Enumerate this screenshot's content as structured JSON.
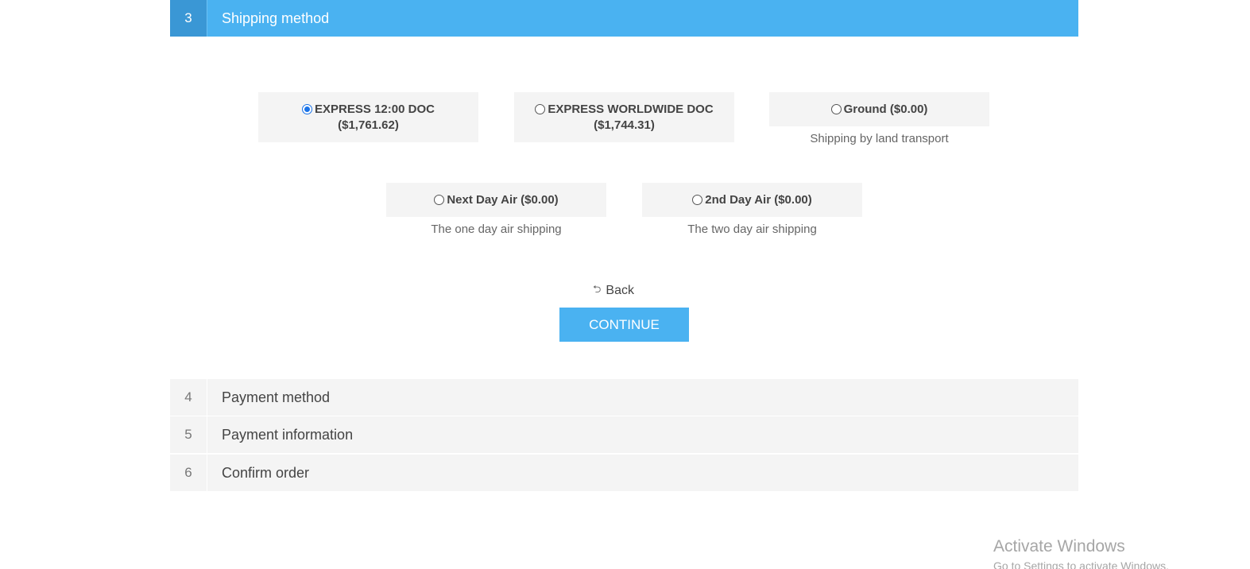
{
  "current_step": {
    "number": "3",
    "title": "Shipping method"
  },
  "methods": [
    {
      "label": "EXPRESS 12:00 DOC",
      "price": "($1,761.62)",
      "selected": true,
      "description": ""
    },
    {
      "label": "EXPRESS WORLDWIDE DOC",
      "price": "($1,744.31)",
      "selected": false,
      "description": ""
    },
    {
      "label": "Ground ($0.00)",
      "price": "",
      "selected": false,
      "description": "Shipping by land transport"
    },
    {
      "label": "Next Day Air ($0.00)",
      "price": "",
      "selected": false,
      "description": "The one day air shipping"
    },
    {
      "label": "2nd Day Air ($0.00)",
      "price": "",
      "selected": false,
      "description": "The two day air shipping"
    }
  ],
  "actions": {
    "back_label": "Back",
    "continue_label": "CONTINUE"
  },
  "steps": [
    {
      "number": "4",
      "title": "Payment method"
    },
    {
      "number": "5",
      "title": "Payment information"
    },
    {
      "number": "6",
      "title": "Confirm order"
    }
  ],
  "watermark": {
    "title": "Activate Windows",
    "subtitle": "Go to Settings to activate Windows."
  },
  "colors": {
    "accent": "#4ab2f1",
    "accent_dark": "#3a97d5",
    "panel": "#f4f4f4"
  },
  "icons": {
    "back": "back-arrow-icon"
  }
}
